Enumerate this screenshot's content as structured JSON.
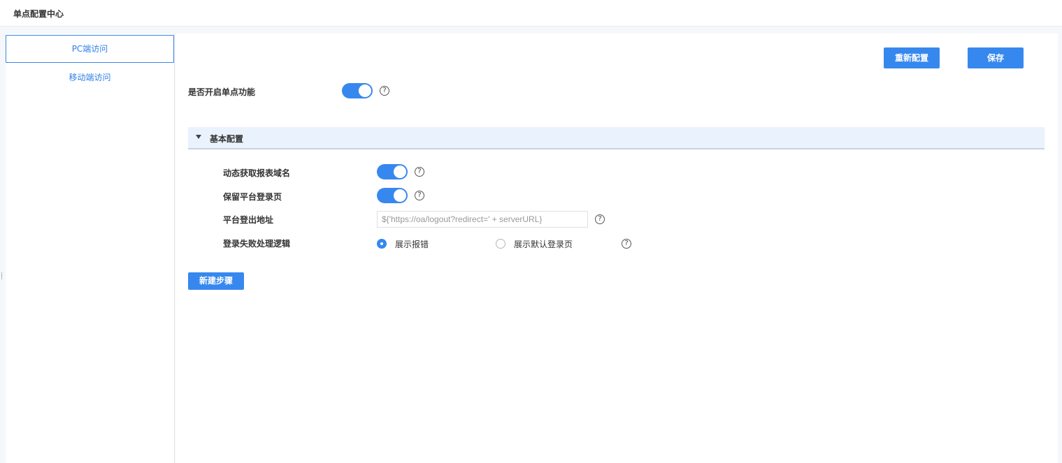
{
  "header": {
    "title": "单点配置中心"
  },
  "sidebar": {
    "items": [
      {
        "label": "PC端访问",
        "active": true
      },
      {
        "label": "移动端访问",
        "active": false
      }
    ]
  },
  "toolbar": {
    "reconfigure_label": "重新配置",
    "save_label": "保存"
  },
  "main": {
    "sso_enable": {
      "label": "是否开启单点功能",
      "on": true
    }
  },
  "basic_config": {
    "title": "基本配置",
    "expanded": true,
    "dynamic_domain": {
      "label": "动态获取报表域名",
      "on": true
    },
    "keep_login_page": {
      "label": "保留平台登录页",
      "on": true
    },
    "logout_url": {
      "label": "平台登出地址",
      "value": "${'https://oa/logout?redirect=' + serverURL}"
    },
    "login_fail": {
      "label": "登录失败处理逻辑",
      "options": [
        {
          "label": "展示报错",
          "checked": true
        },
        {
          "label": "展示默认登录页",
          "checked": false
        }
      ]
    }
  },
  "new_step_label": "新建步骤",
  "colors": {
    "accent": "#3788ee",
    "section_bg": "#eaf2fd"
  },
  "icons": {
    "help": "question-circle-icon",
    "collapse": "triangle-down-icon"
  }
}
